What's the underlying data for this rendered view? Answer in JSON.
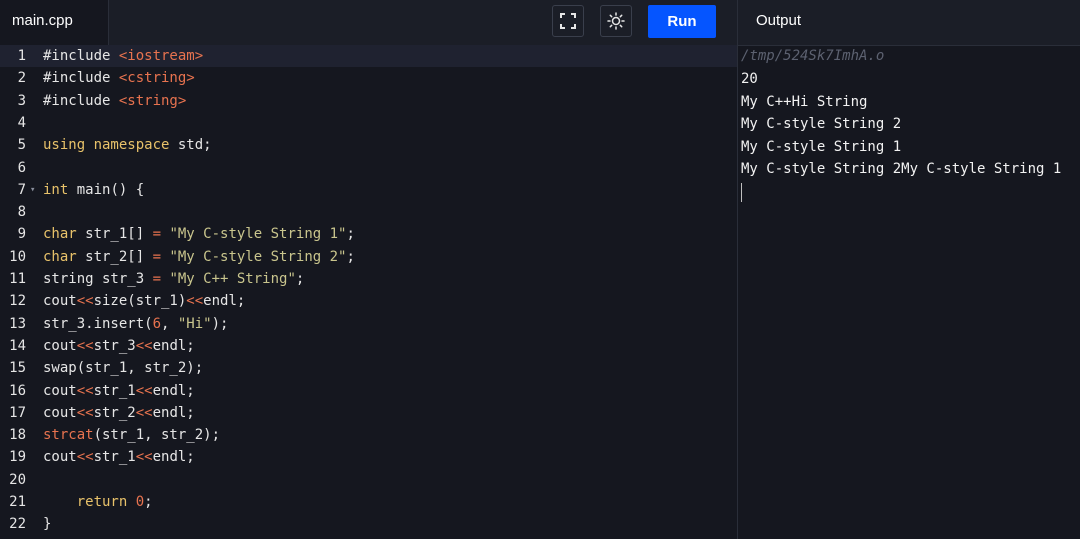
{
  "file_tab": {
    "name": "main.cpp"
  },
  "toolbar": {
    "fullscreen_icon": "fullscreen-icon",
    "theme_icon": "sun-icon",
    "run_label": "Run"
  },
  "output": {
    "title": "Output",
    "lines": [
      "/tmp/524Sk7ImhA.o",
      "20",
      "My C++Hi String",
      "My C-style String 2",
      "My C-style String 1",
      "My C-style String 2My C-style String 1"
    ]
  },
  "editor": {
    "line_numbers": [
      "1",
      "2",
      "3",
      "4",
      "5",
      "6",
      "7",
      "8",
      "9",
      "10",
      "11",
      "12",
      "13",
      "14",
      "15",
      "16",
      "17",
      "18",
      "19",
      "20",
      "21",
      "22"
    ],
    "lines": {
      "l1_a": "#include ",
      "l1_b": "<iostream>",
      "l2_a": "#include ",
      "l2_b": "<cstring>",
      "l3_a": "#include ",
      "l3_b": "<string>",
      "l5_a": "using namespace",
      "l5_b": " std;",
      "l7_a": "int",
      "l7_b": " main() {",
      "l9_a": "char",
      "l9_b": " str_1[] ",
      "l9_c": "=",
      "l9_d": " ",
      "l9_e": "\"My C-style String 1\"",
      "l9_f": ";",
      "l10_a": "char",
      "l10_b": " str_2[] ",
      "l10_c": "=",
      "l10_d": " ",
      "l10_e": "\"My C-style String 2\"",
      "l10_f": ";",
      "l11_a": "string str_3 ",
      "l11_b": "=",
      "l11_c": " ",
      "l11_d": "\"My C++ String\"",
      "l11_e": ";",
      "l12_a": "cout",
      "l12_b": "<<",
      "l12_c": "size(str_1)",
      "l12_d": "<<",
      "l12_e": "endl;",
      "l13_a": "str_3.insert(",
      "l13_b": "6",
      "l13_c": ", ",
      "l13_d": "\"Hi\"",
      "l13_e": ");",
      "l14_a": "cout",
      "l14_b": "<<",
      "l14_c": "str_3",
      "l14_d": "<<",
      "l14_e": "endl;",
      "l15_a": "swap(str_1, str_2);",
      "l16_a": "cout",
      "l16_b": "<<",
      "l16_c": "str_1",
      "l16_d": "<<",
      "l16_e": "endl;",
      "l17_a": "cout",
      "l17_b": "<<",
      "l17_c": "str_2",
      "l17_d": "<<",
      "l17_e": "endl;",
      "l18_a": "strcat",
      "l18_b": "(str_1, str_2);",
      "l19_a": "cout",
      "l19_b": "<<",
      "l19_c": "str_1",
      "l19_d": "<<",
      "l19_e": "endl;",
      "l21_a": "    return",
      "l21_b": " ",
      "l21_c": "0",
      "l21_d": ";",
      "l22_a": "}"
    }
  }
}
